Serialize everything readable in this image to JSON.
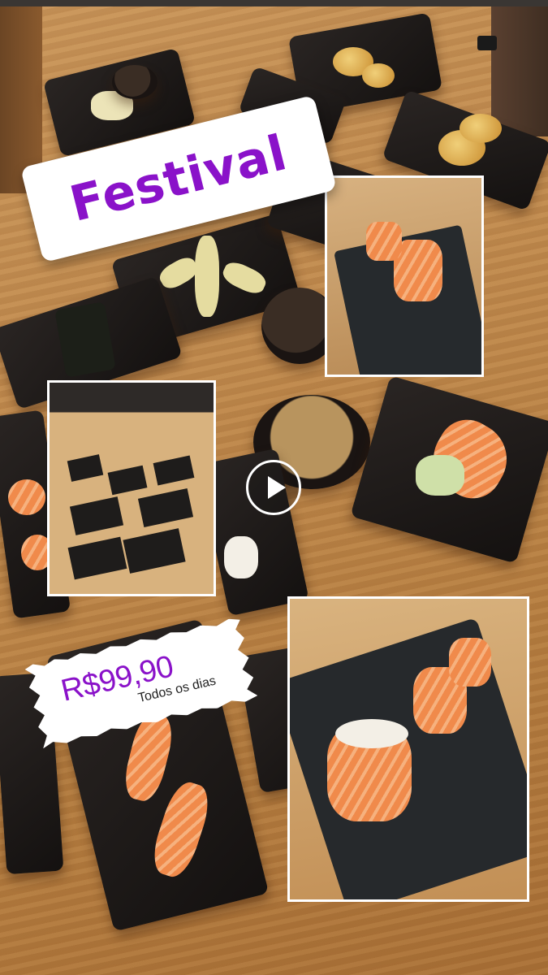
{
  "overlay": {
    "title": "Festival",
    "price": "R$99,90",
    "subtitle": "Todos os dias"
  },
  "colors": {
    "title_color": "#8a12c9",
    "card_background": "#ffffff",
    "table_wood": "#c08a4e"
  },
  "media": {
    "play_icon": "play-icon"
  }
}
